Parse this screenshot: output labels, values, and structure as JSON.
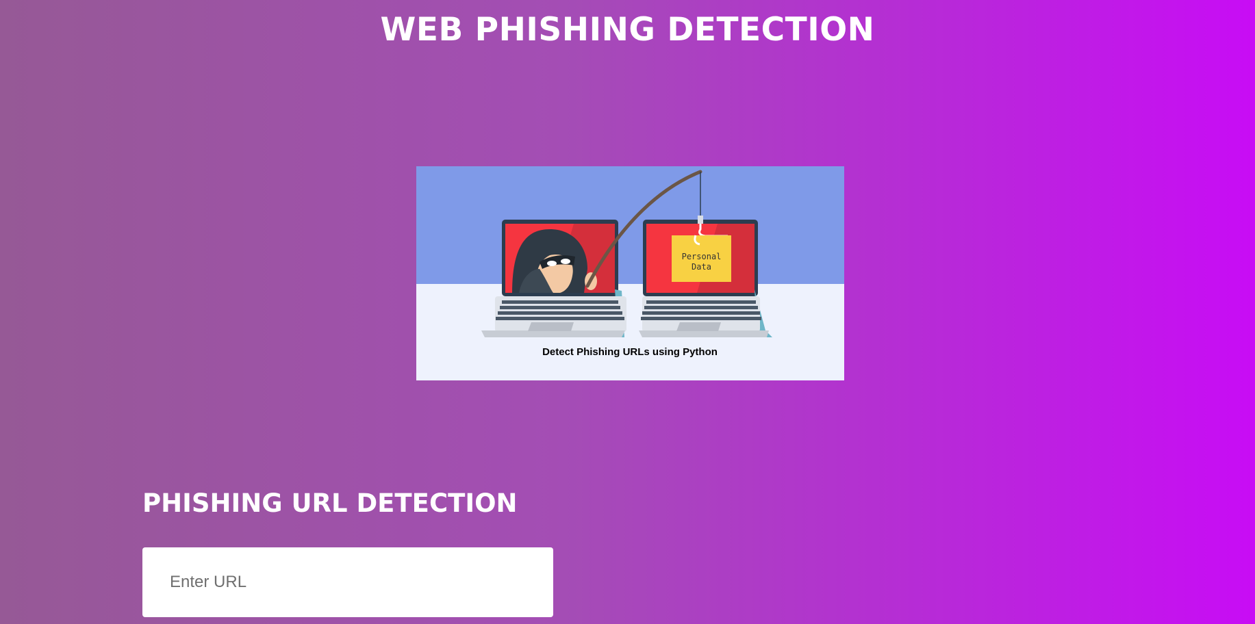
{
  "header": {
    "title": "WEB PHISHING DETECTION"
  },
  "hero": {
    "caption": "Detect Phishing URLs using Python",
    "card_label_line1": "Personal",
    "card_label_line2": "Data",
    "icons": [
      "hacker-icon",
      "laptop-icon",
      "fishing-rod-icon",
      "personal-data-card-icon"
    ]
  },
  "form": {
    "section_title": "PHISHING URL DETECTION",
    "url_input": {
      "placeholder": "Enter URL",
      "value": ""
    }
  },
  "colors": {
    "background_left": "#965996",
    "background_right": "#c80cf5",
    "sky": "#7f9ae8",
    "floor": "#eef2fd",
    "screen": "#f53540",
    "card": "#f8d143"
  }
}
